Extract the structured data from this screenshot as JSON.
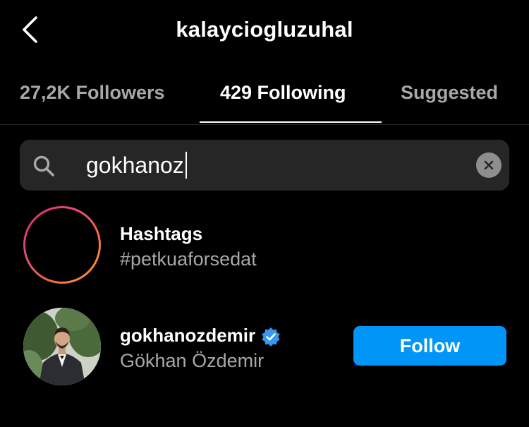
{
  "header": {
    "title": "kalaycioglu​zuhal",
    "back_icon": "chevron-left-icon"
  },
  "tabs": [
    {
      "label": "27,2K Followers",
      "active": false
    },
    {
      "label": "429 Following",
      "active": true
    },
    {
      "label": "Suggested",
      "active": false
    }
  ],
  "search": {
    "value": "gokhanoz",
    "search_icon": "search-icon",
    "clear_icon": "clear-icon"
  },
  "results": [
    {
      "title": "Hashtags",
      "subtitle": "#petkuaforsedat",
      "icon": "hashtag-icon"
    },
    {
      "username": "gokhanozdemir",
      "full_name": "Gökhan Özdemir",
      "verified": true,
      "button": "Follow"
    }
  ],
  "colors": {
    "background": "#000000",
    "accent": "#0095f6",
    "secondary_text": "#a8a8a8",
    "search_bg": "#262626"
  }
}
